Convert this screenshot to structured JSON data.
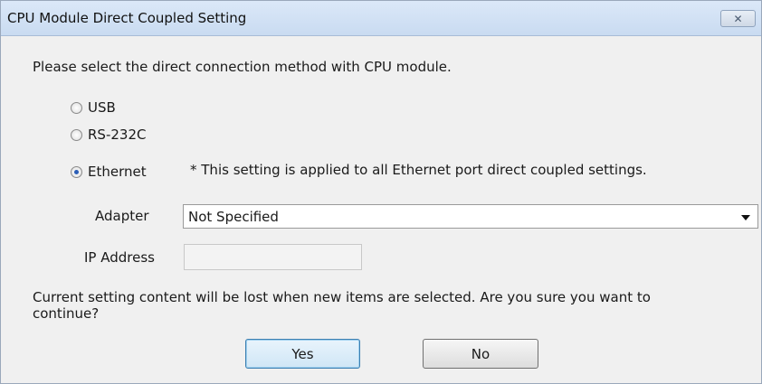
{
  "window": {
    "title": "CPU Module Direct Coupled Setting",
    "close_glyph": "✕"
  },
  "prompt": "Please select the direct connection method with CPU module.",
  "options": [
    {
      "label": "USB",
      "selected": false
    },
    {
      "label": "RS-232C",
      "selected": false
    },
    {
      "label": "Ethernet",
      "selected": true
    }
  ],
  "ethernet_note": "* This setting is applied to all Ethernet port direct coupled settings.",
  "adapter": {
    "label": "Adapter",
    "value": "Not Specified"
  },
  "ip_address": {
    "label": "IP Address",
    "value": ""
  },
  "warning": {
    "line1": "Current setting content will be lost when new items are selected. Are you sure you want to",
    "line2": "continue?"
  },
  "buttons": {
    "yes": "Yes",
    "no": "No"
  }
}
